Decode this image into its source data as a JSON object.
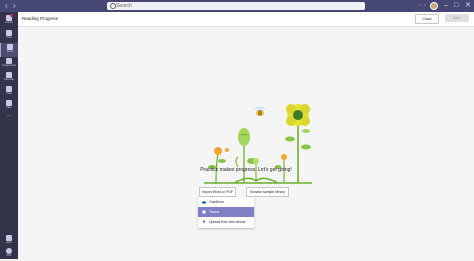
{
  "topbar": {
    "search_placeholder": "Search",
    "more": "···",
    "minimize": "–",
    "maximize": "□",
    "close": "✕"
  },
  "rail": {
    "items": [
      {
        "label": "Activity",
        "icon": "bell-icon"
      },
      {
        "label": "Chat",
        "icon": "chat-icon"
      },
      {
        "label": "Teams",
        "icon": "teams-icon"
      },
      {
        "label": "Assignments",
        "icon": "assignments-icon"
      },
      {
        "label": "Calendar",
        "icon": "calendar-icon"
      },
      {
        "label": "Calls",
        "icon": "phone-icon"
      },
      {
        "label": "Files",
        "icon": "file-icon"
      }
    ],
    "more": "···",
    "apps": "Apps",
    "help": "Help"
  },
  "header": {
    "title": "Reading Progress",
    "close_label": "Close",
    "save_label": "Save"
  },
  "main": {
    "message": "Practice makes progress. Let's get going!",
    "import_label": "Import Word or PDF",
    "browse_label": "Browse sample library",
    "dropdown": [
      {
        "label": "OneDrive",
        "icon": "cloud-icon",
        "selected": false
      },
      {
        "label": "Teams",
        "icon": "teams-icon",
        "selected": true
      },
      {
        "label": "Upload from this device",
        "icon": "upload-icon",
        "selected": false
      }
    ]
  },
  "colors": {
    "teams_purple": "#464775",
    "rail": "#33344a",
    "selection": "#7e7fc4",
    "plant_green": "#6bb02e",
    "flower_yellow": "#e8e33a"
  }
}
